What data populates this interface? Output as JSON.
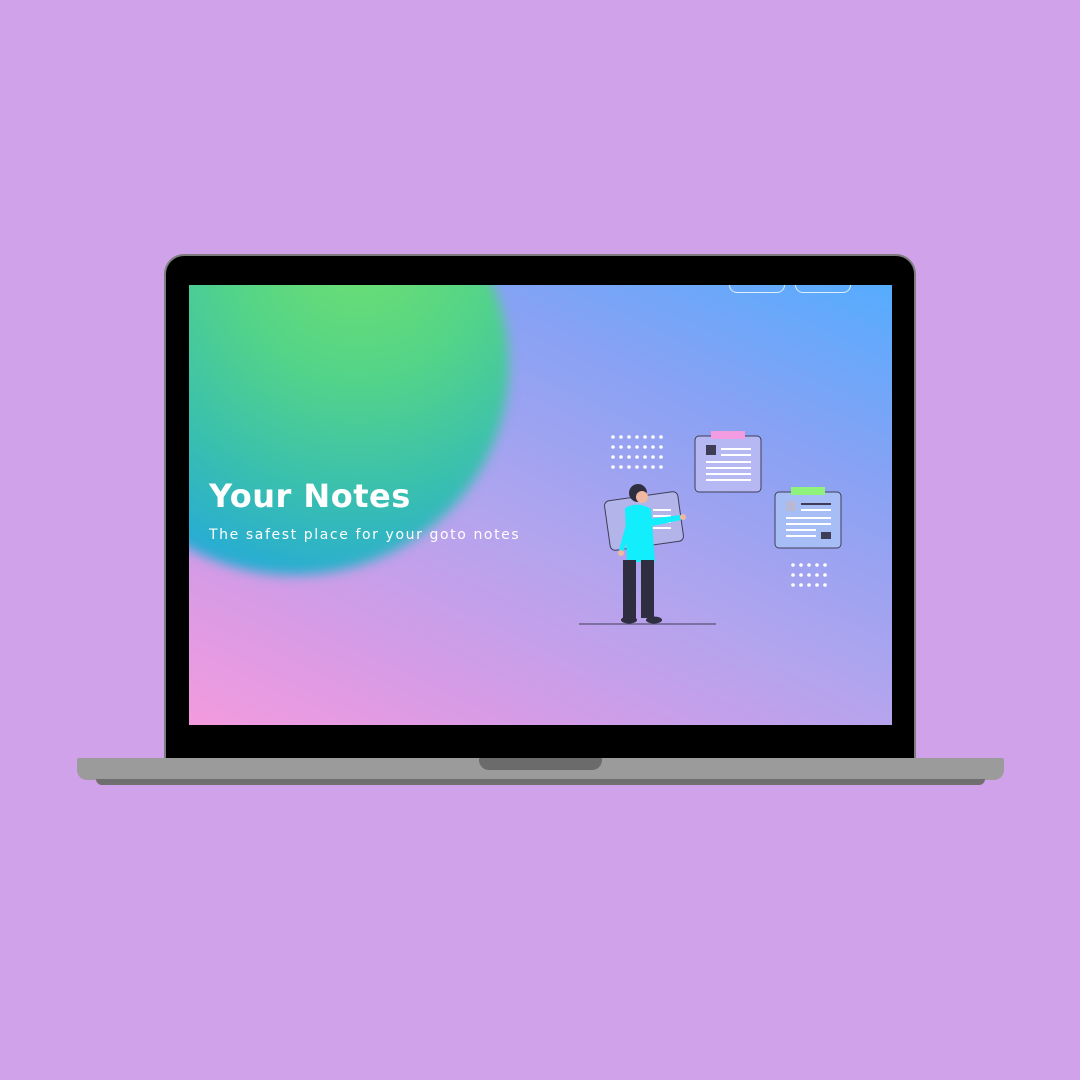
{
  "hero": {
    "title": "Your Notes",
    "subtitle": "The safest place for your goto notes"
  },
  "colors": {
    "page_background": "#cfa2ea",
    "person_shirt": "#12eefc",
    "note_tab_pink": "#f29be0",
    "note_tab_green": "#8ef27c"
  },
  "illustration": {
    "icon": "person-with-notes-illustration"
  }
}
